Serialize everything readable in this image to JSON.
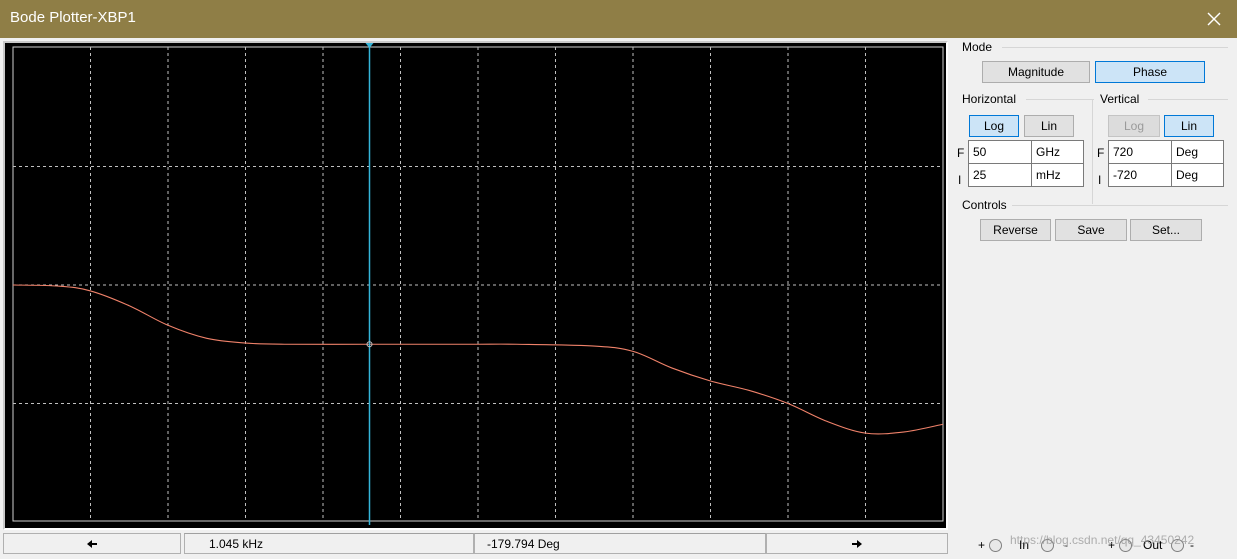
{
  "window": {
    "title": "Bode Plotter-XBP1"
  },
  "mode": {
    "title": "Mode",
    "magnitude_label": "Magnitude",
    "phase_label": "Phase",
    "selected": "Phase"
  },
  "horizontal": {
    "title": "Horizontal",
    "log_label": "Log",
    "lin_label": "Lin",
    "selected": "Log",
    "f_label": "F",
    "f_value": "50",
    "f_unit": "GHz",
    "i_label": "I",
    "i_value": "25",
    "i_unit": "mHz"
  },
  "vertical": {
    "title": "Vertical",
    "log_label": "Log",
    "lin_label": "Lin",
    "selected": "Lin",
    "f_label": "F",
    "f_value": "720",
    "f_unit": "Deg",
    "i_label": "I",
    "i_value": "-720",
    "i_unit": "Deg"
  },
  "controls": {
    "title": "Controls",
    "reverse_label": "Reverse",
    "save_label": "Save",
    "set_label": "Set..."
  },
  "readout": {
    "frequency": "1.045 kHz",
    "phase": "-179.794 Deg"
  },
  "terminals": {
    "plus": "+",
    "minus": "-",
    "in_label": "In",
    "out_label": "Out"
  },
  "watermark": "https://blog.csdn.net/qq_43450242",
  "colors": {
    "title_bar": "#8f7e46",
    "plot_bg": "#000000",
    "trace": "#f0826a",
    "cursor": "#34b4d8",
    "grid": "#c0c0c0"
  },
  "chart_data": {
    "type": "line",
    "x_scale": "log",
    "xlim": [
      "25 mHz",
      "50 GHz"
    ],
    "ylim": [
      -720,
      720
    ],
    "grid": true,
    "grid_divisions": {
      "x": 12,
      "y": 4
    },
    "cursor_readout": {
      "frequency": "1.045 kHz",
      "phase": "-179.794 Deg"
    },
    "series": [
      {
        "points_div": [
          [
            0,
            0
          ],
          [
            0.6,
            -0.02
          ],
          [
            1.0,
            -0.1
          ],
          [
            1.5,
            -0.35
          ],
          [
            2.0,
            -0.68
          ],
          [
            2.5,
            -0.9
          ],
          [
            3.0,
            -0.98
          ],
          [
            3.5,
            -1.0
          ],
          [
            4.6,
            -1.0
          ],
          [
            5.5,
            -1.0
          ],
          [
            6.0,
            -1.0
          ],
          [
            6.5,
            -1.0
          ],
          [
            7.5,
            -1.03
          ],
          [
            8.0,
            -1.12
          ],
          [
            8.5,
            -1.4
          ],
          [
            9.0,
            -1.62
          ],
          [
            9.5,
            -1.78
          ],
          [
            10.0,
            -2.0
          ],
          [
            10.5,
            -2.3
          ],
          [
            11.0,
            -2.5
          ],
          [
            11.5,
            -2.48
          ],
          [
            12.0,
            -2.35
          ]
        ]
      }
    ]
  }
}
